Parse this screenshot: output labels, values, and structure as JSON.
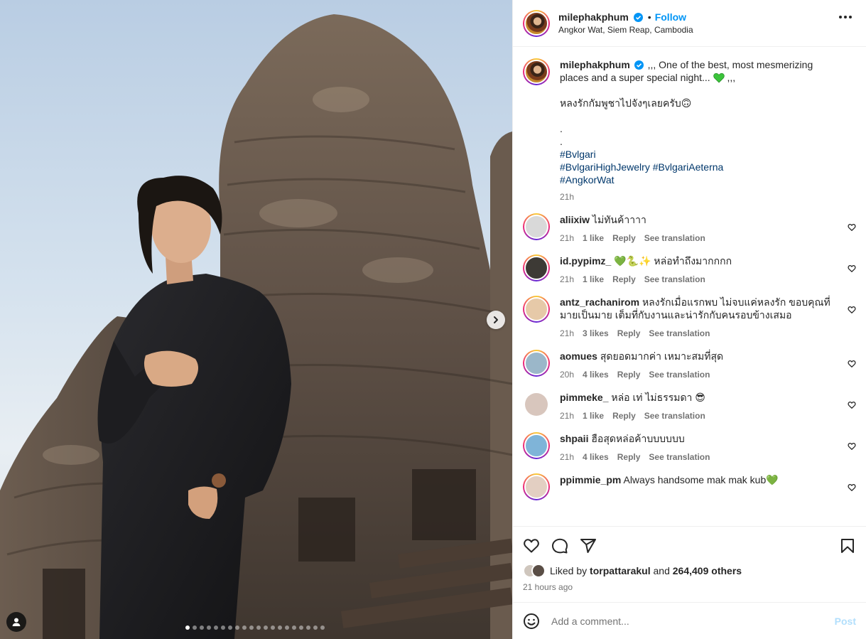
{
  "post": {
    "username": "milephakphum",
    "follow_label": "Follow",
    "bullet": "•",
    "location": "Angkor Wat, Siem Reap, Cambodia",
    "caption_line1": ",,, One of the best, most mesmerizing places and a super special night... ",
    "caption_tail": " ,,,",
    "caption_thai": "หลงรักกัมพูชาไปจังๆเลยครับ🙃",
    "dot1": ".",
    "dot2": ".",
    "hashtags": [
      "#Bvlgari",
      "#BvlgariHighJewelry #BvlgariAeterna",
      "#AngkorWat"
    ],
    "caption_time": "21h",
    "carousel_dots": 20,
    "carousel_active": 0
  },
  "comments": [
    {
      "user": "aliixiw",
      "text": "ไม่ทันค้าาาา",
      "time": "21h",
      "likes": "1 like",
      "reply": "Reply",
      "translate": "See translation",
      "avatar_color": "#d9d9d9",
      "ring": true
    },
    {
      "user": "id.pypimz_",
      "text": "💚🐍✨ หล่อทำถึงมากกกก",
      "time": "21h",
      "likes": "1 like",
      "reply": "Reply",
      "translate": "See translation",
      "avatar_color": "#3d3a35",
      "ring": true
    },
    {
      "user": "antz_rachanirom",
      "text": "หลงรักเมื่อแรกพบ ไม่จบแค่หลงรัก ขอบคุณที่มายเป็นมาย เต็มที่กับงานและน่ารักกับคนรอบข้างเสมอ",
      "time": "21h",
      "likes": "3 likes",
      "reply": "Reply",
      "translate": "See translation",
      "avatar_color": "#e6c9a8",
      "ring": true
    },
    {
      "user": "aomues",
      "text": "สุดยอดมากค่า เหมาะสมที่สุด",
      "time": "20h",
      "likes": "4 likes",
      "reply": "Reply",
      "translate": "See translation",
      "avatar_color": "#9bb7c9",
      "ring": true
    },
    {
      "user": "pimmeke_",
      "text": "หล่อ เท่ ไม่ธรรมดา 😎",
      "time": "21h",
      "likes": "1 like",
      "reply": "Reply",
      "translate": "See translation",
      "avatar_color": "#d8c6bd",
      "ring": false
    },
    {
      "user": "shpaii",
      "text": "ฮือสุดหล่อค้าบบบบบบ",
      "time": "21h",
      "likes": "4 likes",
      "reply": "Reply",
      "translate": "See translation",
      "avatar_color": "#7fb4d8",
      "ring": true
    },
    {
      "user": "ppimmie_pm",
      "text": "Always handsome mak mak kub💚",
      "time": "",
      "likes": "",
      "reply": "",
      "translate": "",
      "avatar_color": "#e3cfc2",
      "ring": true
    }
  ],
  "actions": {
    "liked_by_prefix": "Liked by ",
    "liked_by_user": "torpattarakul",
    "and_label": " and ",
    "others_count": "264,409 others",
    "time_ago": "21 hours ago",
    "add_comment_placeholder": "Add a comment...",
    "post_label": "Post"
  },
  "icons": {
    "verified": "verified-badge-icon",
    "more": "more-options-icon",
    "like": "heart-icon",
    "comment": "comment-icon",
    "share": "share-icon",
    "save": "bookmark-icon",
    "emoji": "emoji-icon",
    "next": "chevron-right-icon",
    "tag": "user-tag-icon"
  },
  "colors": {
    "accent": "#0095f6",
    "hashtag": "#00376b",
    "muted": "#737373",
    "post_disabled": "#b2dffc"
  }
}
